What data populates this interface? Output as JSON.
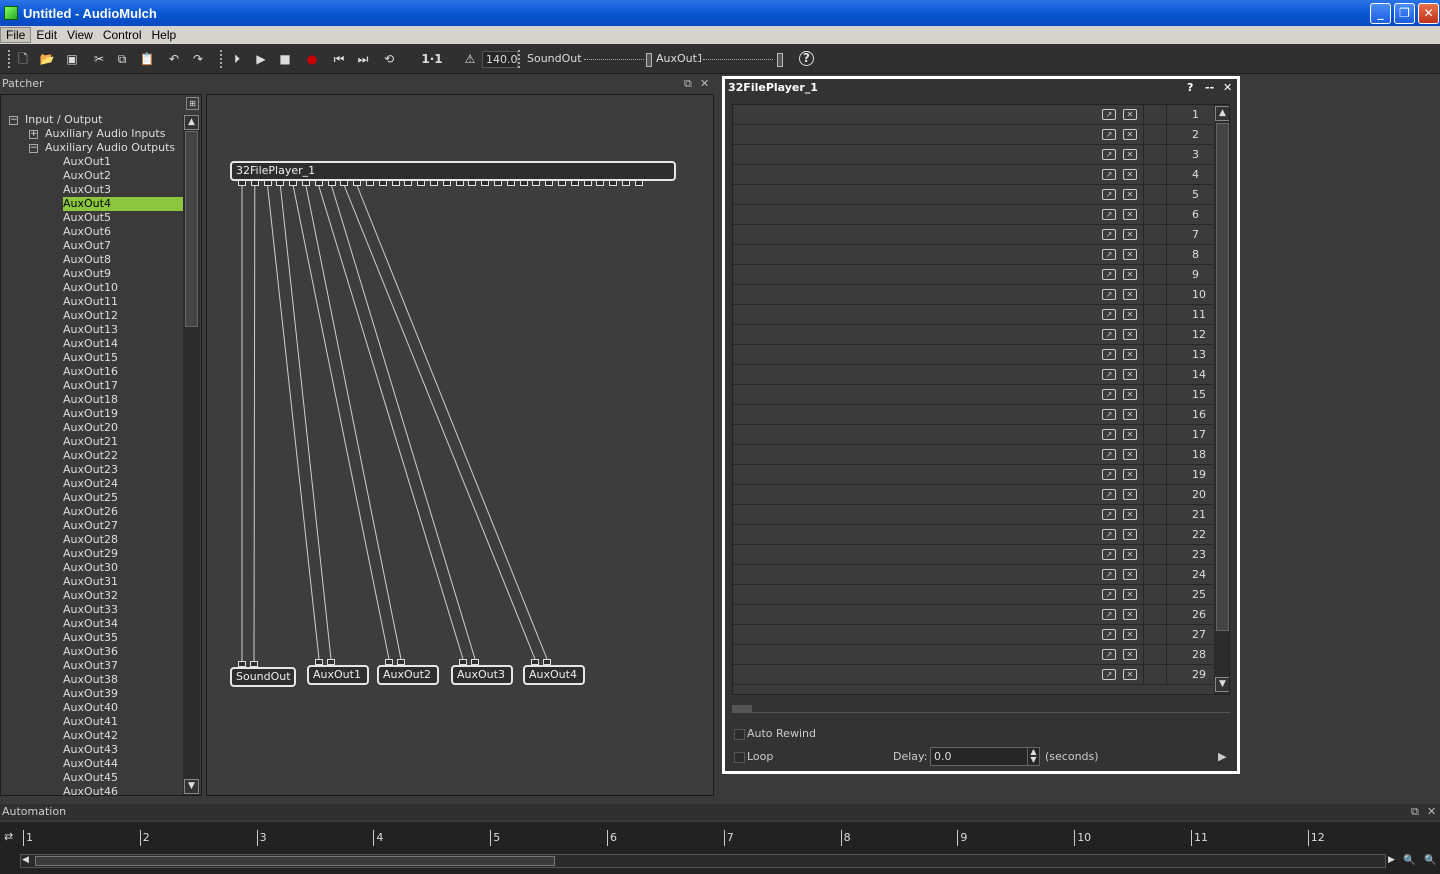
{
  "window": {
    "title": "Untitled - AudioMulch"
  },
  "menu": [
    "File",
    "Edit",
    "View",
    "Control",
    "Help"
  ],
  "toolbar": {
    "ratio": "1·1",
    "tempo": "140.0",
    "output_a": "SoundOut",
    "output_b": "AuxOut1"
  },
  "patcher": {
    "label": "Patcher",
    "tree": {
      "root": "Input / Output",
      "inputs": "Auxiliary Audio Inputs",
      "outputs": "Auxiliary Audio Outputs",
      "selected": "AuxOut4",
      "items": [
        "AuxOut1",
        "AuxOut2",
        "AuxOut3",
        "AuxOut4",
        "AuxOut5",
        "AuxOut6",
        "AuxOut7",
        "AuxOut8",
        "AuxOut9",
        "AuxOut10",
        "AuxOut11",
        "AuxOut12",
        "AuxOut13",
        "AuxOut14",
        "AuxOut15",
        "AuxOut16",
        "AuxOut17",
        "AuxOut18",
        "AuxOut19",
        "AuxOut20",
        "AuxOut21",
        "AuxOut22",
        "AuxOut23",
        "AuxOut24",
        "AuxOut25",
        "AuxOut26",
        "AuxOut27",
        "AuxOut28",
        "AuxOut29",
        "AuxOut30",
        "AuxOut31",
        "AuxOut32",
        "AuxOut33",
        "AuxOut34",
        "AuxOut35",
        "AuxOut36",
        "AuxOut37",
        "AuxOut38",
        "AuxOut39",
        "AuxOut40",
        "AuxOut41",
        "AuxOut42",
        "AuxOut43",
        "AuxOut44",
        "AuxOut45",
        "AuxOut46"
      ]
    },
    "source_node": "32FilePlayer_1",
    "output_nodes": [
      "SoundOut",
      "AuxOut1",
      "AuxOut2",
      "AuxOut3",
      "AuxOut4"
    ]
  },
  "editor": {
    "title": "32FilePlayer_1",
    "help_label": "?",
    "min_label": "--",
    "close_label": "✕",
    "rows": [
      "1",
      "2",
      "3",
      "4",
      "5",
      "6",
      "7",
      "8",
      "9",
      "10",
      "11",
      "12",
      "13",
      "14",
      "15",
      "16",
      "17",
      "18",
      "19",
      "20",
      "21",
      "22",
      "23",
      "24",
      "25",
      "26",
      "27",
      "28",
      "29"
    ],
    "auto_rewind_label": "Auto Rewind",
    "loop_label": "Loop",
    "delay_label": "Delay:",
    "delay_value": "0.0",
    "delay_unit": "(seconds)"
  },
  "automation": {
    "label": "Automation",
    "ticks": [
      "1",
      "2",
      "3",
      "4",
      "5",
      "6",
      "7",
      "8",
      "9",
      "10",
      "11",
      "12"
    ]
  }
}
